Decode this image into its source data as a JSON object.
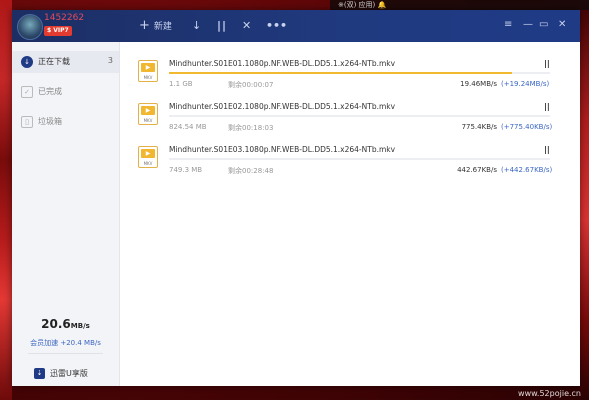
{
  "desktop": {
    "top_text": "※(双) 应用) 🔔",
    "watermark": "www.52pojie.cn"
  },
  "titlebar": {
    "username": "1452262",
    "vip_badge": "$ VIP7",
    "new_icon": "+",
    "new_label": "新建",
    "download_icon": "↓",
    "pause_icon": "||",
    "delete_icon": "✕",
    "more_icon": "•••",
    "menu_icon": "≡",
    "minimize_icon": "—",
    "maximize_icon": "▭",
    "close_icon": "✕"
  },
  "sidebar": {
    "items": [
      {
        "label": "正在下载",
        "count": "3",
        "icon": "↓"
      },
      {
        "label": "已完成",
        "icon": "✓"
      },
      {
        "label": "垃圾箱",
        "icon": "▯"
      }
    ],
    "speed_value": "20.6",
    "speed_unit": "MB/s",
    "member_accel": "会员加速 +20.4 MB/s",
    "uplan_icon": "⇣",
    "uplan_label": "迅雷U享版"
  },
  "tasks": [
    {
      "name": "Mindhunter.S01E01.1080p.NF.WEB-DL.DD5.1.x264-NTb.mkv",
      "size": "1.1 GB",
      "remaining": "剩余00:00:07",
      "speed": "19.46MB/s",
      "accel": "(+19.24MB/s)",
      "progress": 0.9,
      "pause": "||",
      "play": "▶",
      "ext": "MKV"
    },
    {
      "name": "Mindhunter.S01E02.1080p.NF.WEB-DL.DD5.1.x264-NTb.mkv",
      "size": "824.54 MB",
      "remaining": "剩余00:18:03",
      "speed": "775.4KB/s",
      "accel": "(+775.40KB/s)",
      "progress": 0.0,
      "pause": "||",
      "play": "▶",
      "ext": "MKV"
    },
    {
      "name": "Mindhunter.S01E03.1080p.NF.WEB-DL.DD5.1.x264-NTb.mkv",
      "size": "749.3 MB",
      "remaining": "剩余00:28:48",
      "speed": "442.67KB/s",
      "accel": "(+442.67KB/s)",
      "progress": 0.0,
      "pause": "||",
      "play": "▶",
      "ext": "MKV"
    }
  ]
}
